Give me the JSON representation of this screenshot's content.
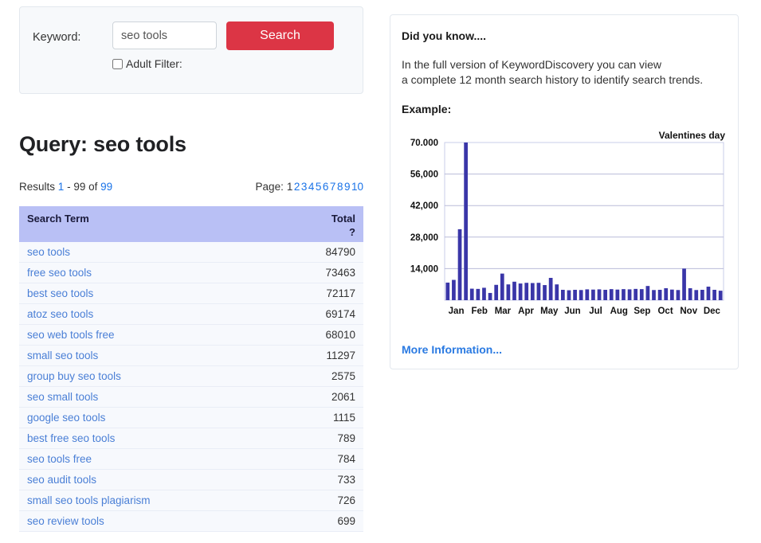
{
  "search_panel": {
    "keyword_label": "Keyword:",
    "keyword_value": "seo tools",
    "keyword_placeholder": "seo tools",
    "search_label": "Search",
    "adult_filter_label": "Adult Filter:",
    "adult_filter_checked": false,
    "button_color": "#dc3545"
  },
  "query": {
    "title": "Query: seo tools"
  },
  "results_bar": {
    "prefix": "Results",
    "from": "1",
    "dash": "-",
    "to": "99",
    "of_label": "of",
    "total": "99",
    "page_label": "Page:",
    "pages": [
      "1",
      "2",
      "3",
      "4",
      "5",
      "6",
      "7",
      "8",
      "9",
      "10"
    ],
    "current_page": "1"
  },
  "table": {
    "headers": [
      "Search Term",
      "Total"
    ],
    "help_symbol": "?",
    "rows": [
      {
        "term": "seo tools",
        "total": "84790"
      },
      {
        "term": "free seo tools",
        "total": "73463"
      },
      {
        "term": "best seo tools",
        "total": "72117"
      },
      {
        "term": "atoz seo tools",
        "total": "69174"
      },
      {
        "term": "seo web tools free",
        "total": "68010"
      },
      {
        "term": "small seo tools",
        "total": "11297"
      },
      {
        "term": "group buy seo tools",
        "total": "2575"
      },
      {
        "term": "seo small tools",
        "total": "2061"
      },
      {
        "term": "google seo tools",
        "total": "1115"
      },
      {
        "term": "best free seo tools",
        "total": "789"
      },
      {
        "term": "seo tools free",
        "total": "784"
      },
      {
        "term": "seo audit tools",
        "total": "733"
      },
      {
        "term": "small seo tools plagiarism",
        "total": "726"
      },
      {
        "term": "seo review tools",
        "total": "699"
      }
    ]
  },
  "info": {
    "title": "Did you know....",
    "body_line1": "In the full version of KeywordDiscovery you can view",
    "body_line2": "a complete 12 month search history to identify search trends.",
    "example_label": "Example:",
    "more_link": "More Information..."
  },
  "chart_data": {
    "type": "bar",
    "title": "",
    "annotation": "Valentines day",
    "xlabel": "",
    "ylabel": "",
    "ylim": [
      0,
      70000
    ],
    "grid": true,
    "bar_color": "#3a36a8",
    "y_ticks": [
      {
        "value": 70000,
        "label": "70.000"
      },
      {
        "value": 56000,
        "label": "56,000"
      },
      {
        "value": 42000,
        "label": "42,000"
      },
      {
        "value": 28000,
        "label": "28,000"
      },
      {
        "value": 14000,
        "label": "14,000"
      }
    ],
    "categories": [
      "Jan",
      "Feb",
      "Mar",
      "Apr",
      "May",
      "Jun",
      "Jul",
      "Aug",
      "Sep",
      "Oct",
      "Nov",
      "Dec"
    ],
    "values": [
      7800,
      9000,
      31500,
      70000,
      5100,
      5000,
      5500,
      3200,
      6800,
      11800,
      7000,
      8200,
      7400,
      7700,
      7600,
      7700,
      6700,
      9900,
      7000,
      4600,
      4400,
      4600,
      4500,
      4800,
      4700,
      4800,
      4600,
      4900,
      4700,
      4900,
      4800,
      5000,
      4900,
      6300,
      4500,
      4600,
      5300,
      4700,
      4500,
      14000,
      5300,
      4500,
      4600,
      6000,
      4600,
      4200
    ]
  }
}
